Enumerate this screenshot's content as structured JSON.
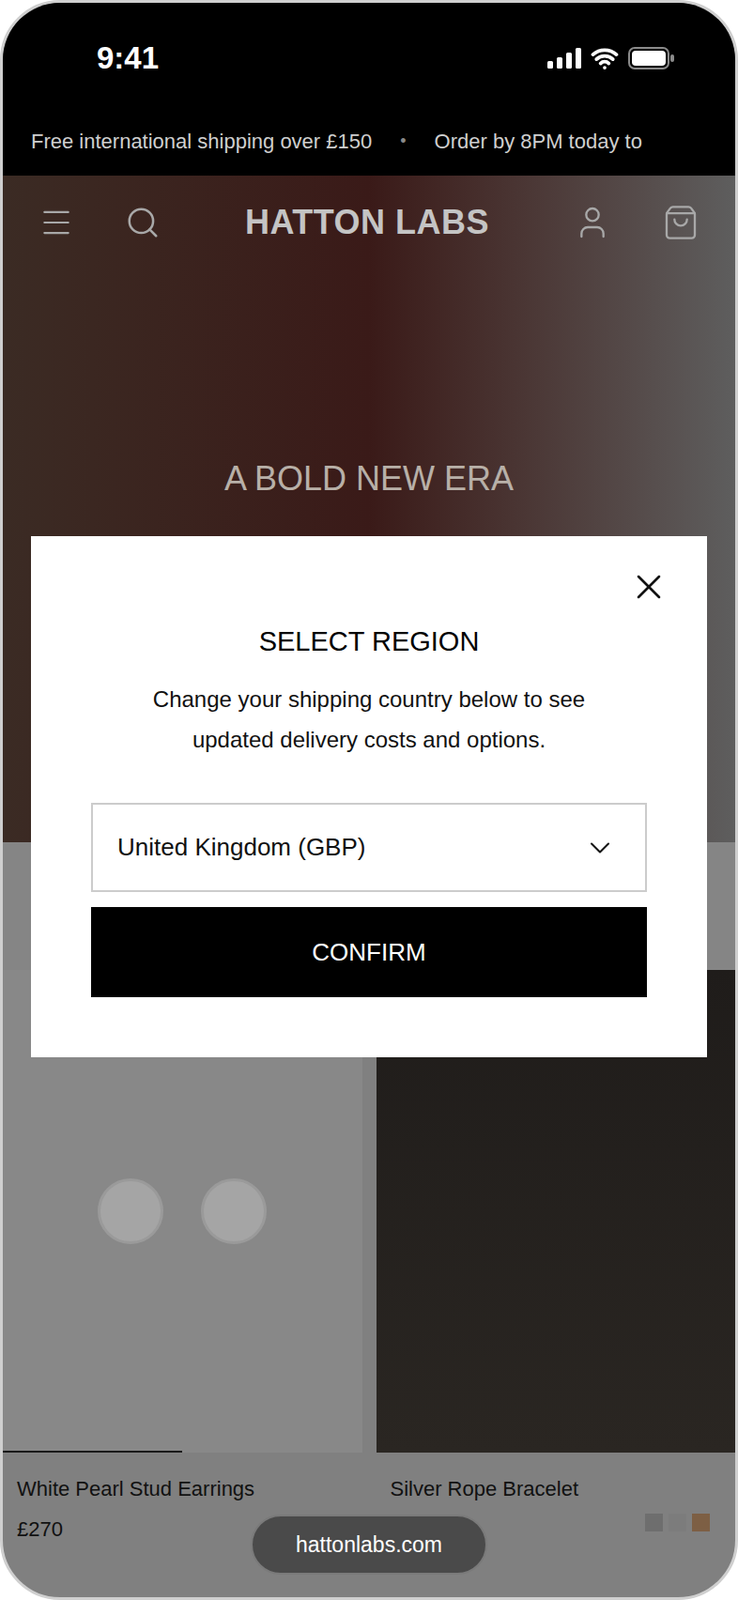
{
  "status_bar": {
    "time": "9:41"
  },
  "announcement": {
    "items": [
      "Free international shipping over £150",
      "Order by 8PM today to"
    ],
    "separator": "•"
  },
  "header": {
    "logo": "HATTON LABS"
  },
  "hero": {
    "heading": "A BOLD NEW ERA"
  },
  "products": [
    {
      "name": "White Pearl Stud Earrings",
      "price": "£270",
      "gallery_level": 0.5,
      "swatches": []
    },
    {
      "name": "Silver Rope Bracelet",
      "price": "",
      "gallery_level": 0,
      "swatches": [
        {
          "color": "#6e6e6e"
        },
        {
          "color": "#7c7c7c"
        },
        {
          "color": "#7d5f44"
        }
      ]
    }
  ],
  "modal": {
    "title": "SELECT REGION",
    "description": "Change your shipping country below to see updated delivery costs and options.",
    "select_value": "United Kingdom (GBP)",
    "button": "CONFIRM"
  },
  "browser": {
    "url": "hattonlabs.com"
  }
}
